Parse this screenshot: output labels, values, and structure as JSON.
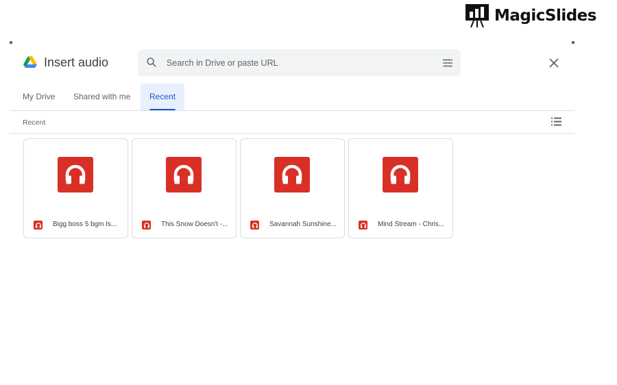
{
  "brand": {
    "name": "MagicSlides"
  },
  "dialog": {
    "title": "Insert audio",
    "search_placeholder": "Search in Drive or paste URL",
    "tabs": [
      {
        "label": "My Drive"
      },
      {
        "label": "Shared with me"
      },
      {
        "label": "Recent",
        "active": true
      }
    ],
    "section_label": "Recent",
    "files": [
      {
        "name": "Bigg boss 5 bgm Is..."
      },
      {
        "name": "This Snow Doesn't -..."
      },
      {
        "name": "Savannah Sunshine..."
      },
      {
        "name": "Mind Stream - Chris..."
      }
    ]
  },
  "colors": {
    "accent": "#1a56c4",
    "audio": "#d93025"
  }
}
